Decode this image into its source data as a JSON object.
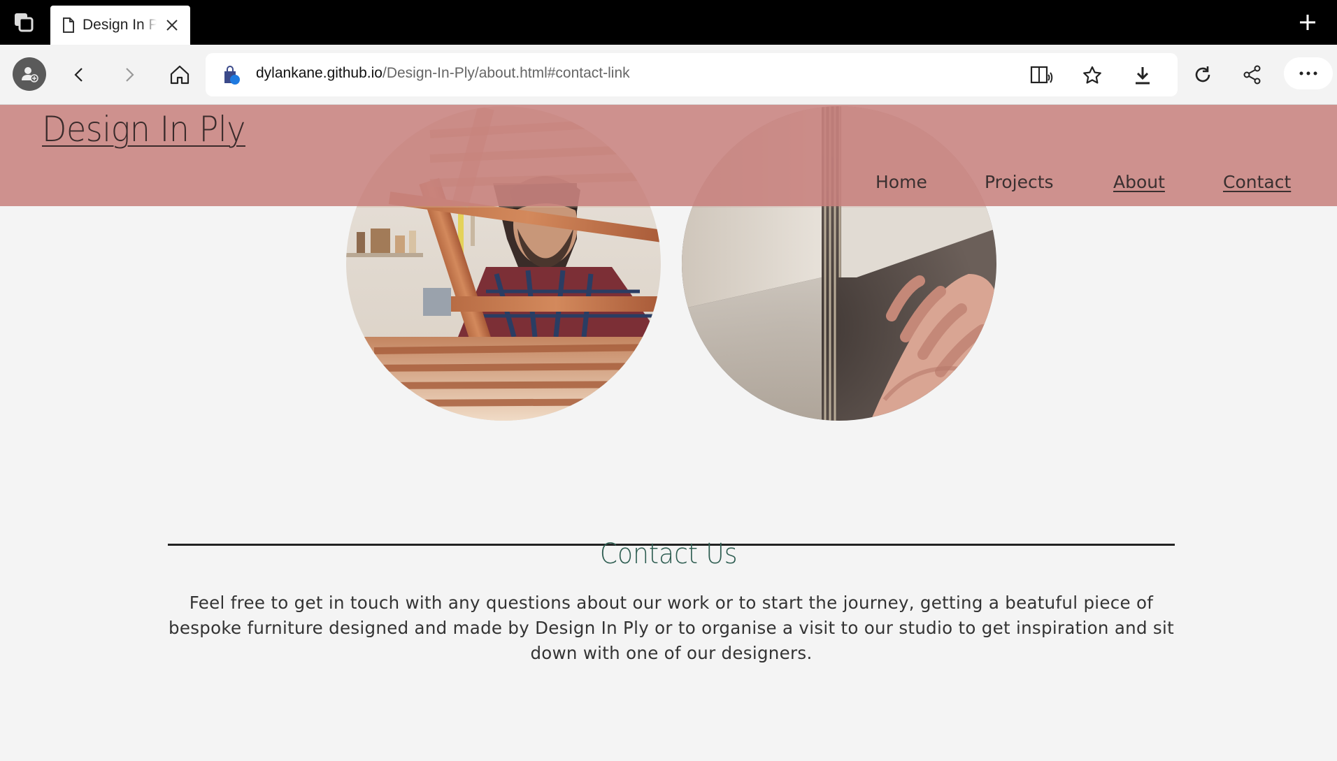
{
  "browser": {
    "tab_title": "Design In Ply",
    "url_host": "dylankane.github.io",
    "url_path": "/Design-In-Ply/about.html#contact-link"
  },
  "site": {
    "logo": "Design In Ply",
    "nav": [
      "Home",
      "Projects",
      "About",
      "Contact"
    ]
  },
  "contact": {
    "title": "Contact Us",
    "text": "Feel free to get in touch with any questions about our work or to start the journey, getting a beatuful piece of bespoke furniture designed and made by Design In Ply or to organise a visit to our studio to get inspiration and sit down with one of our designers."
  },
  "colors": {
    "header": "#c7807d",
    "page_bg": "#f4f4f4",
    "contact_title": "#2f5e52",
    "tab_strip": "#000000"
  }
}
